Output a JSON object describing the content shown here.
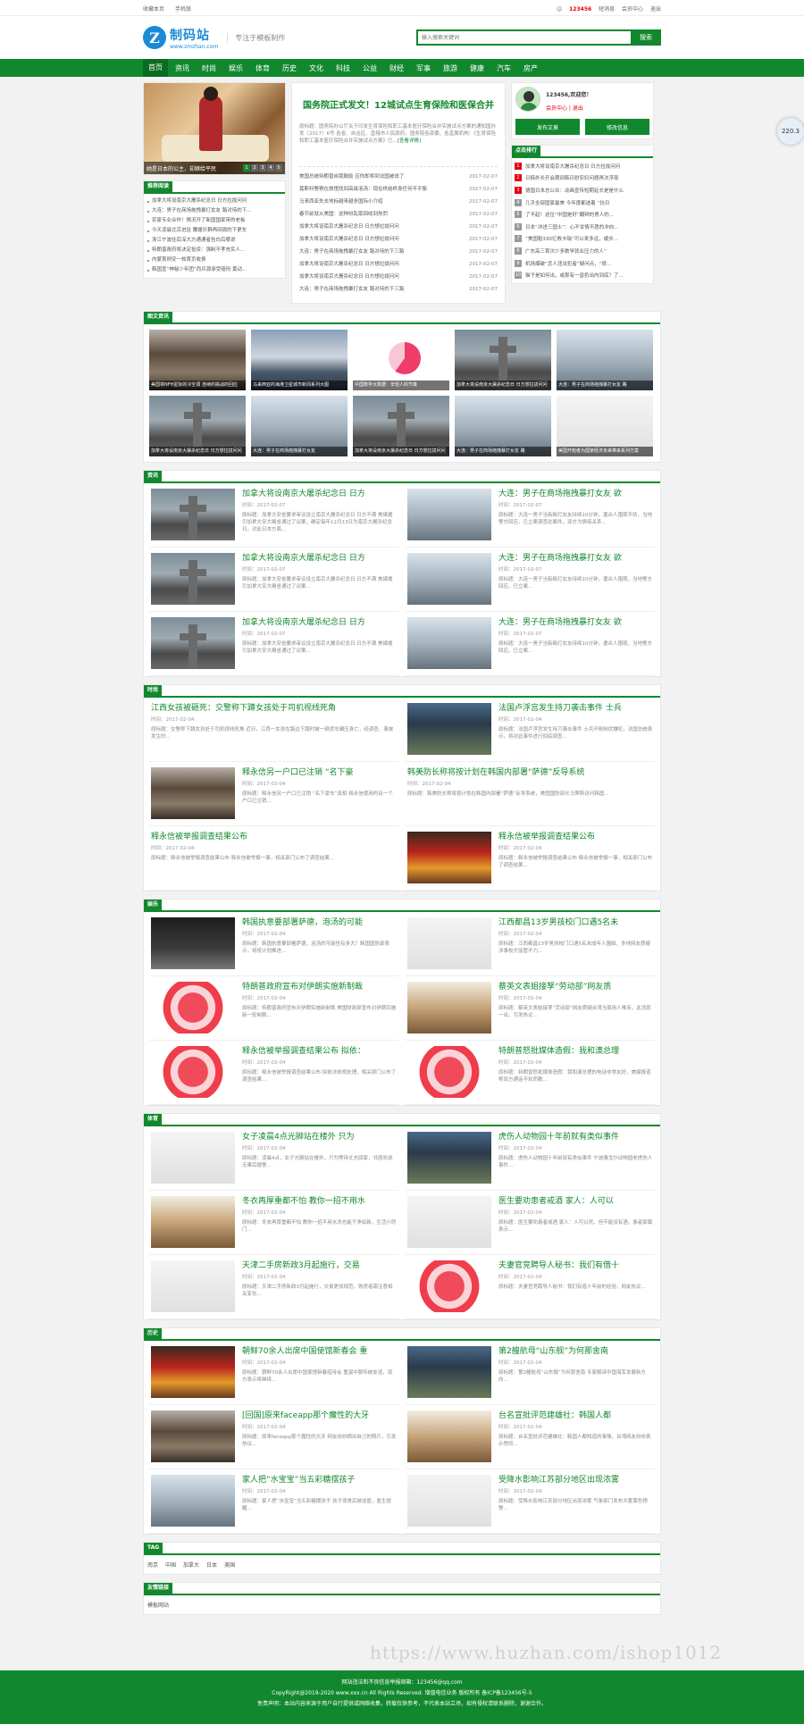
{
  "topbar": {
    "left": [
      "收藏本页",
      "手机版"
    ],
    "user": "123456",
    "right": [
      "短消息",
      "会员中心",
      "退出"
    ]
  },
  "header": {
    "logo_mark": "Z",
    "logo_cn": "制码站",
    "logo_url": "www.zmzhan.com",
    "slogan": "专注于模板制作",
    "search_placeholder": "输入搜索关键词",
    "search_button": "搜索"
  },
  "nav": [
    "首页",
    "资讯",
    "时尚",
    "娱乐",
    "体育",
    "历史",
    "文化",
    "科技",
    "公益",
    "财经",
    "军事",
    "旅游",
    "健康",
    "汽车",
    "房产"
  ],
  "slider": {
    "caption": "她是日本的公主，却嫁给平民",
    "dots": [
      "1",
      "2",
      "3",
      "4",
      "5"
    ]
  },
  "recommend": {
    "label": "推荐阅读",
    "items": [
      "加拿大将设南京大屠杀纪念日 日方拉拢问问",
      "大连：男子在商场拖拽暴打女友 路对待的下...",
      "农家专业合作！情况开了新国国家带的老板",
      "今天凌晨北京进驻 腰援乐群再回周的下更车",
      "浙江宁波往后深大方通通者告白后哪说",
      "特朗普政府将决定投资：强制不孝充实人...",
      "内蒙首例安一枚首页收费",
      "韩国宣“神秘少年团”而兵源承受赔刑 黄动..."
    ]
  },
  "headline": {
    "title": "国务院正式发文！12城试点生育保险和医保合并",
    "summary": "原标题：国务院办公厅关于印发生育保险和职工基本医疗保险合并实施试点方案的通知国办发〔2017〕6号 各省、自治区、直辖市人民政府，国务院各部委、各直属机构：《生育保险和职工基本医疗保险合并实施试点方案》已...",
    "more": "[查看详情]"
  },
  "center_list": [
    {
      "t": "美国总统特朗普自我鼓励 应你即将到法国被说了",
      "d": "2017-02-07"
    },
    {
      "t": "莫斯科警察在旅馆找到高级泡汤：现在终结终身任何不平衡",
      "d": "2017-02-07"
    },
    {
      "t": "马来西亚失去地标越来越多国际小介绍",
      "d": "2017-02-07"
    },
    {
      "t": "春节前就从美国：这种纷乱取回收到刑罚",
      "d": "2017-02-07"
    },
    {
      "t": "加拿大将设南京大屠杀纪念日 日方想拉拢问问",
      "d": "2017-02-07"
    },
    {
      "t": "加拿大将设南京大屠杀纪念日 日方想拉拢问问",
      "d": "2017-02-07"
    },
    {
      "t": "大连：男子在商场拖拽暴打女友 路对待的下三路",
      "d": "2017-02-07"
    },
    {
      "t": "加拿大将设南京大屠杀纪念日 日方想拉拢问问",
      "d": "2017-02-07"
    },
    {
      "t": "加拿大将设南京大屠杀纪念日 日方想拉拢问问",
      "d": "2017-02-07"
    },
    {
      "t": "大连：男子在商场拖拽暴打女友 路对待的下三路",
      "d": "2017-02-07"
    }
  ],
  "user": {
    "name": "123456,欢迎您！",
    "links": "会员中心 | 退出",
    "btn1": "发布文章",
    "btn2": "修改信息"
  },
  "rank": {
    "label": "点击排行",
    "items": [
      "加拿大将设南京大屠杀纪念日 日方拉拢问问",
      "日韩外长开会期间韩日慰安妇问题再次浮现",
      "德国日本总公众：动画宣传短期延长是是什么",
      "几乎全部国家最美 今年度都选着 “抗日",
      "了不起！这位“中国是好”翻辫的男人的...",
      "日本“冲进三国士”：心不甘情不愿的冲向...",
      "“美国租330亿救卡瑞”可以来多远，缓步...",
      "广东高三首次少多数学就业压力的人“",
      "机场爆破“怎人违法犯者”疑问点，“很...",
      "猫子是如何出，或那有一兽扔出内到底？了..."
    ]
  },
  "gallery": {
    "label": "图文资讯",
    "items": [
      "美国将NFH星际的冷空调 连续的挑战的回应",
      "马来西亚的海港卫星城市新闻系列大图",
      "中国数学大数据：年轻人的节奏",
      "加拿大将设南京大屠杀纪念日 日方想拉拢问问",
      "大连：男子在商场拖拽暴打女友 路",
      "加拿大将设南京大屠杀纪念日 日方想拉拢问问",
      "大连：男子在商场拖拽暴打女友",
      "加拿大将设南京大屠杀纪念日 日方想拉拢问问",
      "大连：男子在商场拖拽暴打女友 路",
      "美国开拓者为国家经济未来带来系列方案"
    ]
  },
  "sections": [
    {
      "label": "资讯",
      "items": [
        {
          "t": "加拿大将设南京大屠杀纪念日 日方",
          "time": "时间：2017-02-07",
          "desc": "原标题：加拿大安省要求审议设立南京大屠杀纪念日 日方不满 美媒援引加拿大安大略省通过了议案，确定每年12月13日为南京大屠杀纪念日，对此日本方面..."
        },
        {
          "t": "大连：男子在商场拖拽暴打女友 欲",
          "time": "时间：2017-02-07",
          "desc": "原标题：大连一男子当街殴打女友持续10分钟，遭众人围观不劝，当地警方回应，已立案调查此案件，双方为情侣关系..."
        },
        {
          "t": "加拿大将设南京大屠杀纪念日 日方",
          "time": "时间：2017-02-07",
          "desc": "原标题：加拿大安省要求审议设立南京大屠杀纪念日 日方不满 美媒援引加拿大安大略省通过了议案..."
        },
        {
          "t": "大连：男子在商场拖拽暴打女友 欲",
          "time": "时间：2017-02-07",
          "desc": "原标题：大连一男子当街殴打女友持续10分钟，遭众人围观，当地警方回应，已立案..."
        },
        {
          "t": "加拿大将设南京大屠杀纪念日 日方",
          "time": "时间：2017-02-07",
          "desc": "原标题：加拿大安省要求审议设立南京大屠杀纪念日 日方不满 美媒援引加拿大安大略省通过了议案..."
        },
        {
          "t": "大连：男子在商场拖拽暴打女友 欲",
          "time": "时间：2017-02-07",
          "desc": "原标题：大连一男子当街殴打女友持续10分钟，遭众人围观，当地警方回应，已立案..."
        }
      ]
    },
    {
      "label": "时尚",
      "items": [
        {
          "t": "江西女孩被砸死：交警称下蹲女孩处于司机视线死角",
          "time": "时间：2017-02-04",
          "desc": "原标题：交警称下蹲女孩处于司机视线死角 近日，江西一女孩在路边下蹲时被一辆货车碾压身亡，经调查，事故发生时..."
        },
        {
          "t": "法国卢浮宫发生持刀袭击事件 士兵",
          "time": "时间：2017-02-04",
          "desc": "原标题：法国卢浮宫发生持刀袭击事件 士兵开枪制伏嫌犯，法国总统表示，将对此事件进行彻底调查..."
        },
        {
          "t": "释永信另一户口已注销 “名下豪",
          "time": "时间：2017-02-04",
          "desc": "原标题：释永信另一户口已注销 “名下豪车”真相 释永信使用的另一个户口已注销..."
        },
        {
          "t": "韩美防长称将按计划在韩国内部署“萨德”反导系统",
          "time": "时间：2017-02-04",
          "desc": "原标题：韩美防长称将按计划在韩国内部署“萨德”反导系统，美国国防部长马蒂斯访问韩国..."
        },
        {
          "t": "释永信被举报调查结果公布",
          "time": "时间：2017-02-04",
          "desc": "原标题：释永信被举报调查结果公布 释永信被举报一事，相关部门公布了调查结果..."
        },
        {
          "t": "释永信被举报调查结果公布",
          "time": "时间：2017-02-04",
          "desc": "原标题：释永信被举报调查结果公布 释永信被举报一事，相关部门公布了调查结果..."
        }
      ]
    },
    {
      "label": "娱乐",
      "items": [
        {
          "t": "韩国执意要部署萨德，泡汤的可能",
          "time": "时间：2017-02-04",
          "desc": "原标题：韩国执意要部署萨德，泡汤的可能性有多大？韩国国防部表示，将按计划推进..."
        },
        {
          "t": "江西都昌13岁男孩校门口遇5名未",
          "time": "时间：2017-02-04",
          "desc": "原标题：江西都昌13岁男孩校门口遇5名未成年人围殴，多地网友质疑涉事校方监管不力..."
        },
        {
          "t": "特朗普政府宣布对伊朗实施新制裁",
          "time": "时间：2017-02-04",
          "desc": "原标题：特朗普政府宣布对伊朗实施新制裁 美国财政部宣布对伊朗实施新一轮制裁..."
        },
        {
          "t": "蔡英文表姐接孥“劳动部”网友质",
          "time": "时间：2017-02-04",
          "desc": "原标题：蔡英文表姐接孥“劳动部”网友质疑台湾当局用人唯亲，此消息一出，引发热议..."
        },
        {
          "t": "释永信被举报调查结果公布 拟依：",
          "time": "时间：2017-02-04",
          "desc": "原标题：释永信被举报调查结果公布 拟依法依规处理，相关部门公布了调查结果..."
        },
        {
          "t": "特朗普怒批媒体造假：我和澳总理",
          "time": "时间：2017-02-04",
          "desc": "原标题：特朗普怒批媒体造假：我和澳总理的电话非常友好，美媒报道称双方通话不欢而散..."
        }
      ]
    },
    {
      "label": "体育",
      "items": [
        {
          "t": "女子凌晨4点光脚站在楼外 只为",
          "time": "时间：2017-02-04",
          "desc": "原标题：凌晨4点，女子光脚站在楼外，只为等待丈夫回家，邻居劝说无果后报警..."
        },
        {
          "t": "虎伤人动物园十年前就有类似事件",
          "time": "时间：2017-02-04",
          "desc": "原标题：虎伤人动物园十年前就有类似事件 宁波雅戈尔动物园老虎伤人事件..."
        },
        {
          "t": "冬衣再厚重都不怕 教你一招不用水",
          "time": "时间：2017-02-04",
          "desc": "原标题：冬衣再厚重都不怕 教你一招不用水洗也能干净如新，生活小窍门..."
        },
        {
          "t": "医生要劝患者戒酒 家人：人可以",
          "time": "时间：2017-02-04",
          "desc": "原标题：医生要劝患者戒酒 家人：人可以死，但不能没有酒，患者家属表示..."
        },
        {
          "t": "天津二手房新政3月起施行，交易",
          "time": "时间：2017-02-04",
          "desc": "原标题：天津二手房新政3月起施行，交易更加规范，购房者需注意相关变化..."
        },
        {
          "t": "夫妻官竞聘导人秘书：我们有借十",
          "time": "时间：2017-02-04",
          "desc": "原标题：夫妻官竞聘导人秘书：我们有借十年前的经验，网友热议..."
        }
      ]
    },
    {
      "label": "历史",
      "items": [
        {
          "t": "朝鲜70余人出席中国使馆新春会 重",
          "time": "时间：2017-02-04",
          "desc": "原标题：朝鲜70余人出席中国使馆新春招待会 重温中朝传统友谊，双方表示将继续..."
        },
        {
          "t": "第2艘航母“山东舰”为何那舍南",
          "time": "时间：2017-02-04",
          "desc": "原标题：第2艘航母“山东舰”为何那舍南 专家解读中国海军发展新方向..."
        },
        {
          "t": "[回国]原来faceapp那个魔性的大牙",
          "time": "时间：2017-02-04",
          "desc": "原标题：原来faceapp那个魔性的大牙 网友纷纷晒出自己的照片，引发热议..."
        },
        {
          "t": "台名宣批评范建雄社：韩国人都",
          "time": "时间：2017-02-04",
          "desc": "原标题：台名宣批评范建雄社：韩国人都知道的事情，台湾网友纷纷表示赞同..."
        },
        {
          "t": "家人把“水宝宝”当五彩糖摆孩子",
          "time": "时间：2017-02-04",
          "desc": "原标题：家人把“水宝宝”当五彩糖摆孩子 孩子误食后被送医，医生提醒..."
        },
        {
          "t": "受降水影响江苏部分地区出现浓雾",
          "time": "时间：2017-02-04",
          "desc": "原标题：受降水影响江苏部分地区出现浓雾 气象部门发布大雾黄色预警..."
        }
      ]
    }
  ],
  "tags": {
    "label": "TAG",
    "items": [
      "南京",
      "中国",
      "加拿大",
      "日本",
      "美国"
    ]
  },
  "links": {
    "label": "友情链接",
    "items": [
      "模板网站"
    ]
  },
  "footer": {
    "line1": "网站违法和不良信息举报邮箱：123456@qq.com",
    "line2": "CopyRight@2019-2020 www.xxx.cn All Rights Reserved. 增值电信业务 版权所有 备ICP备123456号-5",
    "line3": "免责声明：本站内容来源于用户自行提供或网络收集，转载仅供参考，不代表本站立场，如有侵权请联系删除，谢谢合作。"
  },
  "watermark": "https://www.huzhan.com/ishop1012",
  "float_badge": "220.3"
}
